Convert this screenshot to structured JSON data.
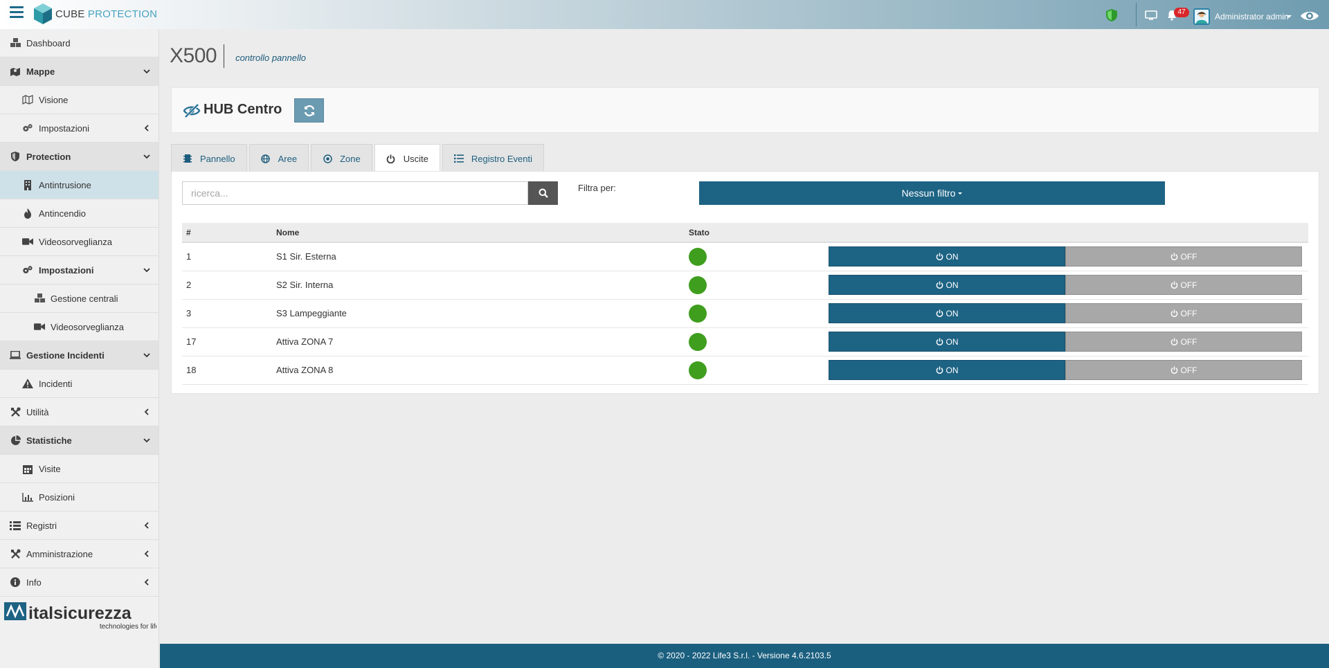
{
  "app": {
    "logo_part1": "CUBE",
    "logo_part2": "PROTECTION",
    "notification_count": "47",
    "user_name": "Administrator admin"
  },
  "sidebar": {
    "items": [
      {
        "label": "Dashboard",
        "icon": "cubes-icon"
      },
      {
        "label": "Mappe",
        "icon": "map-marker-icon"
      },
      {
        "label": "Visione",
        "icon": "map-icon"
      },
      {
        "label": "Impostazioni",
        "icon": "gears-icon"
      },
      {
        "label": "Protection",
        "icon": "shield-icon"
      },
      {
        "label": "Antintrusione",
        "icon": "building-icon"
      },
      {
        "label": "Antincendio",
        "icon": "fire-icon"
      },
      {
        "label": "Videosorveglianza",
        "icon": "video-camera-icon"
      },
      {
        "label": "Impostazioni",
        "icon": "gears-icon"
      },
      {
        "label": "Gestione centrali",
        "icon": "cubes-icon"
      },
      {
        "label": "Videosorveglianza",
        "icon": "video-camera-icon"
      },
      {
        "label": "Gestione Incidenti",
        "icon": "laptop-icon"
      },
      {
        "label": "Incidenti",
        "icon": "warning-icon"
      },
      {
        "label": "Utilità",
        "icon": "tools-icon"
      },
      {
        "label": "Statistiche",
        "icon": "pie-chart-icon"
      },
      {
        "label": "Visite",
        "icon": "calendar-icon"
      },
      {
        "label": "Posizioni",
        "icon": "bar-chart-icon"
      },
      {
        "label": "Registri",
        "icon": "list-icon"
      },
      {
        "label": "Amministrazione",
        "icon": "tools-icon"
      },
      {
        "label": "Info",
        "icon": "info-icon"
      }
    ],
    "brand_name": "italsicurezza",
    "brand_tagline": "technologies for life"
  },
  "page": {
    "title": "X500",
    "subtitle": "controllo pannello",
    "hub_title": "HUB Centro"
  },
  "tabs": [
    {
      "label": "Pannello",
      "icon": "chip-icon"
    },
    {
      "label": "Aree",
      "icon": "globe-icon"
    },
    {
      "label": "Zone",
      "icon": "dot-circle-icon"
    },
    {
      "label": "Uscite",
      "icon": "power-icon"
    },
    {
      "label": "Registro Eventi",
      "icon": "list-icon"
    }
  ],
  "search": {
    "placeholder": "ricerca...",
    "value": ""
  },
  "filter": {
    "label": "Filtra per:",
    "button": "Nessun filtro"
  },
  "table": {
    "headers": [
      "#",
      "Nome",
      "Stato"
    ],
    "on_label": "ON",
    "off_label": "OFF",
    "status_color": "#3f9e1e",
    "rows": [
      {
        "id": "1",
        "name": "S1 Sir. Esterna"
      },
      {
        "id": "2",
        "name": "S2 Sir. Interna"
      },
      {
        "id": "3",
        "name": "S3 Lampeggiante"
      },
      {
        "id": "17",
        "name": "Attiva ZONA 7"
      },
      {
        "id": "18",
        "name": "Attiva ZONA 8"
      }
    ]
  },
  "footer": {
    "text": "© 2020 - 2022 Life3 S.r.l. - Versione 4.6.2103.5"
  },
  "colors": {
    "primary": "#1d6384",
    "off": "#a8a8a8",
    "accent": "#48a2c0"
  }
}
